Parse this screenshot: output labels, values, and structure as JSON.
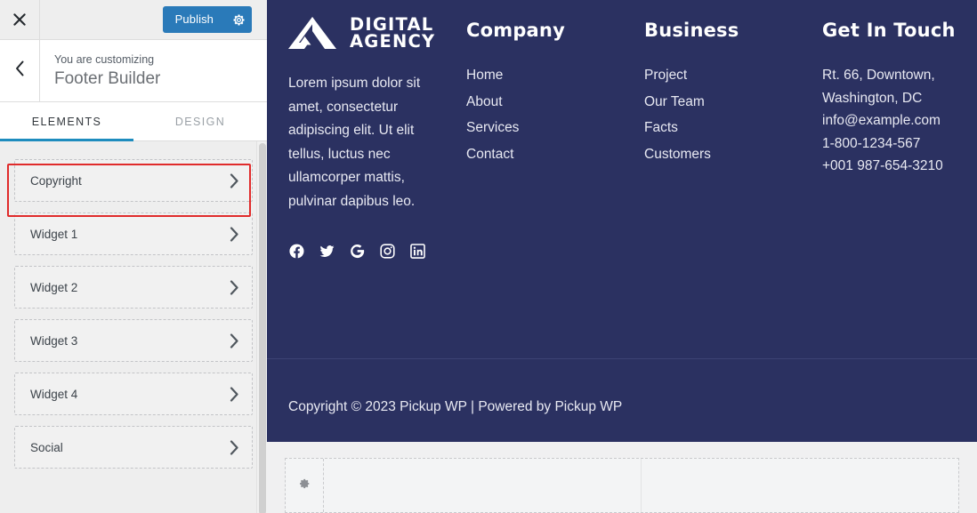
{
  "sidebar": {
    "close_icon": "close-icon",
    "publish": {
      "label": "Publish",
      "gear_icon": "gear-icon",
      "color": "#2a7ab9"
    },
    "back_icon": "chevron-left-icon",
    "kicker": "You are customizing",
    "title": "Footer Builder",
    "tabs": [
      {
        "label": "ELEMENTS",
        "active": true
      },
      {
        "label": "DESIGN",
        "active": false
      }
    ],
    "accent_color": "#1e8cbe",
    "highlight_color": "#e02b2b",
    "elements": [
      {
        "label": "Copyright",
        "chevron": "chevron-right-icon",
        "highlighted": true
      },
      {
        "label": "Widget 1",
        "chevron": "chevron-right-icon",
        "highlighted": false
      },
      {
        "label": "Widget 2",
        "chevron": "chevron-right-icon",
        "highlighted": false
      },
      {
        "label": "Widget 3",
        "chevron": "chevron-right-icon",
        "highlighted": false
      },
      {
        "label": "Widget 4",
        "chevron": "chevron-right-icon",
        "highlighted": false
      },
      {
        "label": "Social",
        "chevron": "chevron-right-icon",
        "highlighted": false
      }
    ]
  },
  "preview": {
    "footer_bg": "#2b3161",
    "brand": {
      "logo_icon": "mountain-logo-icon",
      "logo_line1": "DIGITAL",
      "logo_line2": "AGENCY",
      "paragraph": "Lorem ipsum dolor sit amet, consectetur adipiscing elit. Ut elit tellus, luctus nec ullamcorper mattis, pulvinar dapibus leo.",
      "social": [
        {
          "name": "facebook-icon"
        },
        {
          "name": "twitter-icon"
        },
        {
          "name": "google-icon"
        },
        {
          "name": "instagram-icon"
        },
        {
          "name": "linkedin-icon"
        }
      ]
    },
    "company": {
      "heading": "Company",
      "links": [
        "Home",
        "About",
        "Services",
        "Contact"
      ]
    },
    "business": {
      "heading": "Business",
      "links": [
        "Project",
        "Our Team",
        "Facts",
        "Customers"
      ]
    },
    "contact": {
      "heading": "Get In Touch",
      "lines": [
        "Rt. 66, Downtown,",
        "Washington, DC",
        "info@example.com",
        "1-800-1234-567",
        "+001 987-654-3210"
      ]
    },
    "copyright": "Copyright © 2023 Pickup WP | Powered by Pickup WP",
    "builder": {
      "gear_icon": "gear-icon"
    }
  }
}
